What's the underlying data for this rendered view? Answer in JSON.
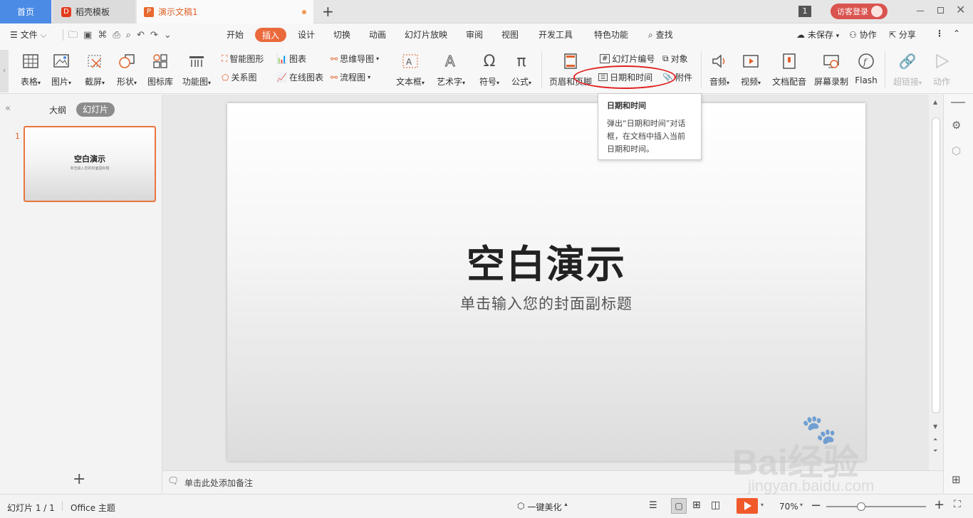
{
  "titlebar": {
    "tabs": [
      {
        "label": "首页"
      },
      {
        "label": "稻壳模板"
      },
      {
        "label": "演示文稿1"
      }
    ],
    "window_badge": "1",
    "login_label": "访客登录"
  },
  "menubar": {
    "file_label": "文件",
    "tabs": [
      "开始",
      "插入",
      "设计",
      "切换",
      "动画",
      "幻灯片放映",
      "审阅",
      "视图",
      "开发工具",
      "特色功能"
    ],
    "search_label": "查找",
    "unsaved_label": "未保存",
    "collab_label": "协作",
    "share_label": "分享"
  },
  "ribbon": {
    "table": "表格",
    "picture": "图片",
    "screenshot": "截屏",
    "shape": "形状",
    "icon_lib": "图标库",
    "func_chart": "功能图",
    "smart_art": "智能图形",
    "chart": "图表",
    "mind_map": "思维导图",
    "relation": "关系图",
    "online_chart": "在线图表",
    "flow_chart": "流程图",
    "textbox": "文本框",
    "wordart": "艺术字",
    "symbol": "符号",
    "formula": "公式",
    "header_footer": "页眉和页脚",
    "slide_number": "幻灯片编号",
    "object": "对象",
    "date_time": "日期和时间",
    "attachment": "附件",
    "audio": "音频",
    "video": "视频",
    "doc_voice": "文档配音",
    "screen_record": "屏幕录制",
    "flash": "Flash",
    "hyperlink": "超链接",
    "action": "动作"
  },
  "tooltip": {
    "title": "日期和时间",
    "body": "弹出“日期和时间”对话框，在文档中插入当前日期和时间。"
  },
  "left_panel": {
    "tab_outline": "大纲",
    "tab_slides": "幻灯片",
    "slide_index": "1",
    "thumb_title": "空白演示",
    "thumb_subtitle": "单击输入您的封面副标题"
  },
  "slide": {
    "title": "空白演示",
    "subtitle": "单击输入您的封面副标题"
  },
  "notes": {
    "placeholder": "单击此处添加备注"
  },
  "statusbar": {
    "slide_count": "幻灯片 1 / 1",
    "theme": "Office 主题",
    "beautify": "一键美化",
    "zoom": "70%"
  },
  "watermark": {
    "brand": "Bai经验",
    "url": "jingyan.baidu.com"
  },
  "colors": {
    "accent": "#ea6a3c",
    "home_tab": "#4b8be6",
    "highlight_ring": "#e02020",
    "play_button": "#f05a2a"
  }
}
